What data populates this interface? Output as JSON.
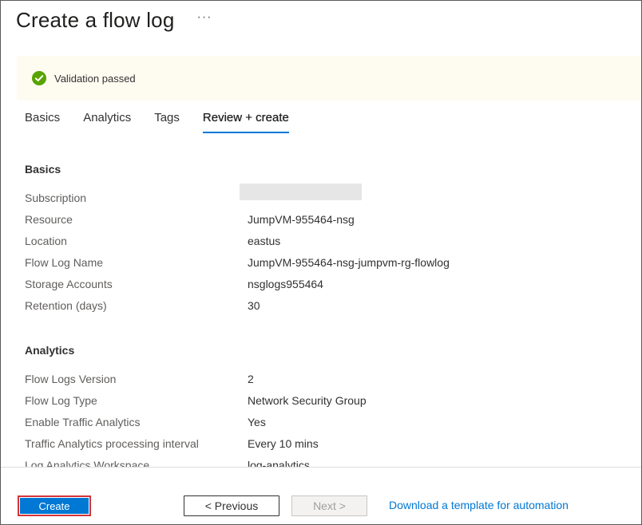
{
  "header": {
    "title": "Create a flow log",
    "more": "···"
  },
  "banner": {
    "text": "Validation passed",
    "color": "#57a300"
  },
  "tabs": [
    {
      "label": "Basics",
      "active": false
    },
    {
      "label": "Analytics",
      "active": false
    },
    {
      "label": "Tags",
      "active": false
    },
    {
      "label": "Review + create",
      "active": true
    }
  ],
  "basics": {
    "title": "Basics",
    "rows": [
      {
        "label": "Subscription",
        "value": ""
      },
      {
        "label": "Resource",
        "value": "JumpVM-955464-nsg"
      },
      {
        "label": "Location",
        "value": "eastus"
      },
      {
        "label": "Flow Log Name",
        "value": "JumpVM-955464-nsg-jumpvm-rg-flowlog"
      },
      {
        "label": "Storage Accounts",
        "value": "nsglogs955464"
      },
      {
        "label": "Retention (days)",
        "value": "30"
      }
    ]
  },
  "analytics": {
    "title": "Analytics",
    "rows": [
      {
        "label": "Flow Logs Version",
        "value": "2"
      },
      {
        "label": "Flow Log Type",
        "value": "Network Security Group"
      },
      {
        "label": "Enable Traffic Analytics",
        "value": "Yes"
      },
      {
        "label": "Traffic Analytics processing interval",
        "value": "Every 10 mins"
      },
      {
        "label": "Log Analytics Workspace",
        "value": "log-analytics"
      }
    ]
  },
  "footer": {
    "create_label": "Create",
    "previous_label": "< Previous",
    "next_label": "Next >",
    "download_link": "Download a template for automation"
  },
  "colors": {
    "accent": "#0078d4",
    "highlight_border": "#d13438"
  }
}
